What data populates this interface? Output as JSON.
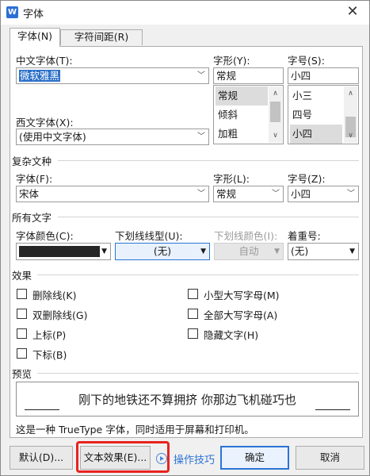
{
  "window": {
    "title": "字体",
    "app_icon_letter": "W",
    "close_glyph": "✕"
  },
  "tabs": [
    {
      "label": "字体(N)",
      "active": true
    },
    {
      "label": "字符间距(R)",
      "active": false
    }
  ],
  "chinese_font": {
    "label": "中文字体(T):",
    "value": "微软雅黑"
  },
  "style": {
    "label": "字形(Y):",
    "value": "常规",
    "options": [
      "常规",
      "倾斜",
      "加粗"
    ],
    "selected": "常规"
  },
  "size": {
    "label": "字号(S):",
    "value": "小四",
    "options": [
      "小三",
      "四号",
      "小四"
    ],
    "selected": "小四"
  },
  "western_font": {
    "label": "西文字体(X):",
    "value": "(使用中文字体)"
  },
  "complex": {
    "section_title": "复杂文种",
    "font_label": "字体(F):",
    "font_value": "宋体",
    "style_label": "字形(L):",
    "style_value": "常规",
    "size_label": "字号(Z):",
    "size_value": "小四"
  },
  "all_text": {
    "section_title": "所有文字",
    "color_label": "字体颜色(C):",
    "color_value": "#262626",
    "underline_label": "下划线线型(U):",
    "underline_value": "(无)",
    "underline_color_label": "下划线颜色(I):",
    "underline_color_value": "自动",
    "emphasis_label": "着重号:",
    "emphasis_value": "(无)"
  },
  "effects": {
    "section_title": "效果",
    "left": [
      {
        "label": "删除线(K)",
        "checked": false
      },
      {
        "label": "双删除线(G)",
        "checked": false
      },
      {
        "label": "上标(P)",
        "checked": false
      },
      {
        "label": "下标(B)",
        "checked": false
      }
    ],
    "right": [
      {
        "label": "小型大写字母(M)",
        "checked": false
      },
      {
        "label": "全部大写字母(A)",
        "checked": false
      },
      {
        "label": "隐藏文字(H)",
        "checked": false
      }
    ]
  },
  "preview": {
    "section_title": "预览",
    "text": "刚下的地铁还不算拥挤  你那边飞机碰巧也",
    "note": "这是一种 TrueType 字体，同时适用于屏幕和打印机。"
  },
  "buttons": {
    "default": "默认(D)...",
    "text_effects": "文本效果(E)...",
    "tips": "操作技巧",
    "ok": "确定",
    "cancel": "取消"
  },
  "colors": {
    "accent": "#2b74d6",
    "highlight": "#e8231f",
    "selection": "#2a6fc9"
  }
}
